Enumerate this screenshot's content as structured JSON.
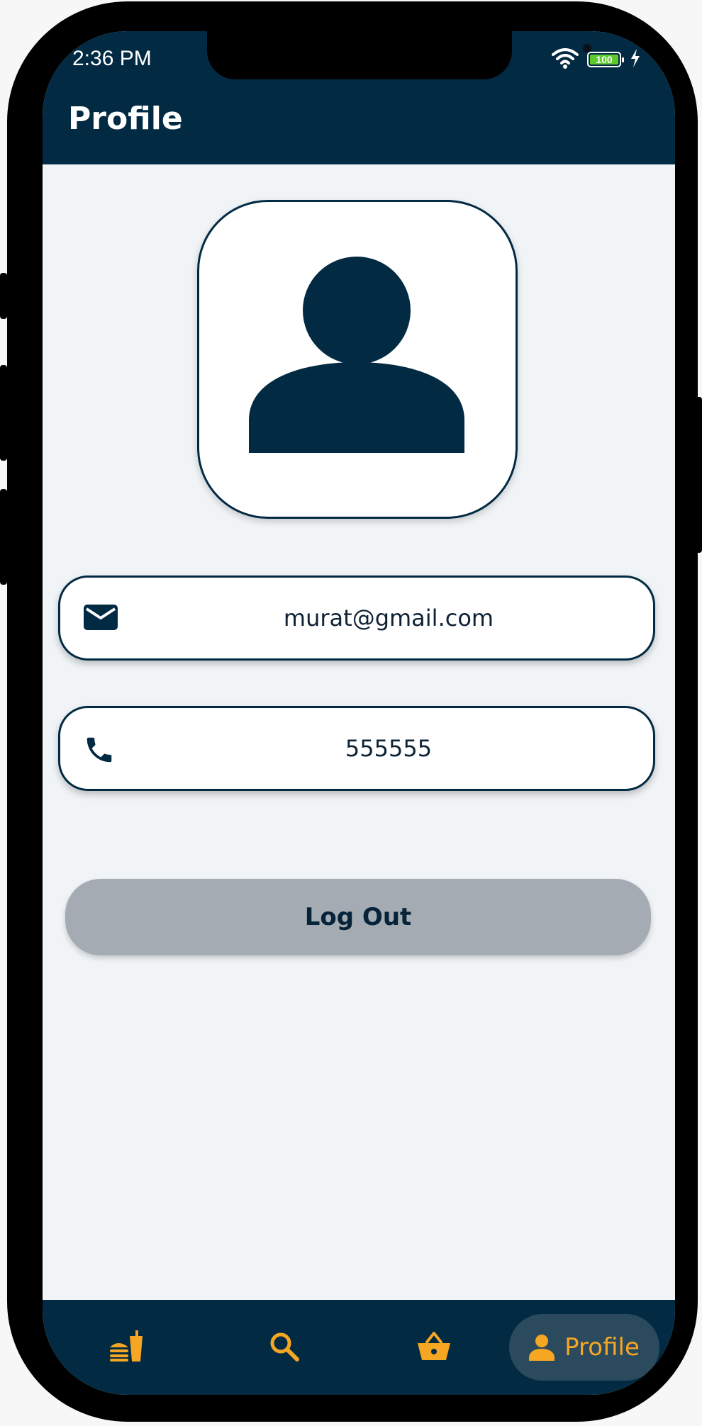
{
  "status_bar": {
    "time": "2:36 PM",
    "battery_level": "100",
    "icons": [
      "wifi-icon",
      "battery-icon",
      "charging-icon"
    ]
  },
  "header": {
    "title": "Profile"
  },
  "profile": {
    "avatar_icon": "person-icon",
    "email": "murat@gmail.com",
    "email_icon": "mail-icon",
    "phone": "555555",
    "phone_icon": "phone-icon"
  },
  "actions": {
    "logout_label": "Log Out"
  },
  "bottom_nav": {
    "items": [
      {
        "icon": "fastfood-icon"
      },
      {
        "icon": "search-icon"
      },
      {
        "icon": "basket-icon"
      },
      {
        "icon": "person-icon",
        "label": "Profile",
        "active": true
      }
    ]
  },
  "colors": {
    "primary": "#022a43",
    "accent": "#f5a623",
    "background": "#f0f4f6",
    "button": "#a4abb2"
  }
}
